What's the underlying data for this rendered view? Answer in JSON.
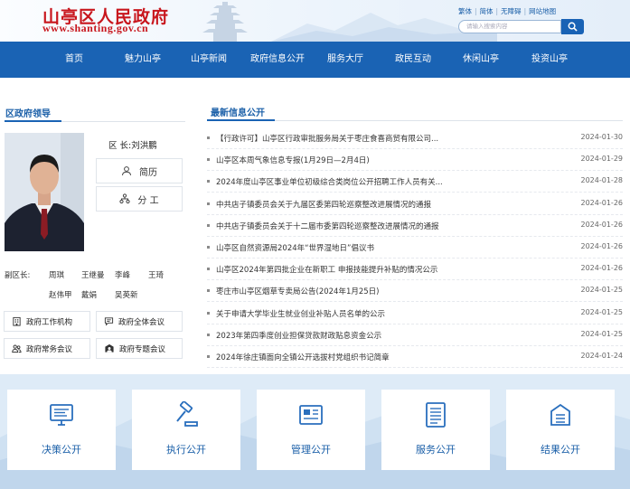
{
  "header": {
    "logo_text": "山亭区人民政府",
    "logo_url": "www.shanting.gov.cn",
    "links": [
      "繁体",
      "简体",
      "无障碍",
      "网站地图"
    ],
    "search_placeholder": "请输入搜索内容"
  },
  "nav": [
    "首页",
    "魅力山亭",
    "山亭新闻",
    "政府信息公开",
    "服务大厅",
    "政民互动",
    "休闲山亭",
    "投资山亭"
  ],
  "leader": {
    "section_title": "区政府领导",
    "name_line": "区 长:刘洪鹏",
    "resume_label": "简历",
    "duty_label": "分 工",
    "deputy_label": "副区长:",
    "deputies": [
      "周琪",
      "王继曼",
      "李峰",
      "王琦",
      "赵伟甲",
      "戴娟",
      "吴英新"
    ]
  },
  "quick_links": [
    "政府工作机构",
    "政府全体会议",
    "政府常务会议",
    "政府专题会议"
  ],
  "news": {
    "section_title": "最新信息公开",
    "items": [
      {
        "title": "【行政许可】山亭区行政审批服务局关于枣庄食喜商贸有限公司...",
        "date": "2024-01-30"
      },
      {
        "title": "山亭区本周气象信息专报(1月29日—2月4日)",
        "date": "2024-01-29"
      },
      {
        "title": "2024年度山亭区事业单位初级综合类岗位公开招聘工作人员有关...",
        "date": "2024-01-28"
      },
      {
        "title": "中共店子镇委员会关于九届区委第四轮巡察整改进展情况的通报",
        "date": "2024-01-26"
      },
      {
        "title": "中共店子镇委员会关于十二届市委第四轮巡察整改进展情况的通报",
        "date": "2024-01-26"
      },
      {
        "title": "山亭区自然资源局2024年“世界湿地日”倡议书",
        "date": "2024-01-26"
      },
      {
        "title": "山亭区2024年第四批企业在新职工 申报技能提升补贴的情况公示",
        "date": "2024-01-26"
      },
      {
        "title": "枣庄市山亭区烟草专卖局公告(2024年1月25日)",
        "date": "2024-01-25"
      },
      {
        "title": "关于申请大学毕业生就业创业补贴人员名单的公示",
        "date": "2024-01-25"
      },
      {
        "title": "2023年第四季度创业担保贷款财政贴息资金公示",
        "date": "2024-01-25"
      },
      {
        "title": "2024年徐庄镇面向全镇公开选拔村党组织书记简章",
        "date": "2024-01-24"
      }
    ]
  },
  "cards": [
    "决策公开",
    "执行公开",
    "管理公开",
    "服务公开",
    "结果公开"
  ],
  "colors": {
    "brand_blue": "#1a63b4",
    "logo_red": "#c8161d",
    "band_bg": "#deebf7"
  }
}
